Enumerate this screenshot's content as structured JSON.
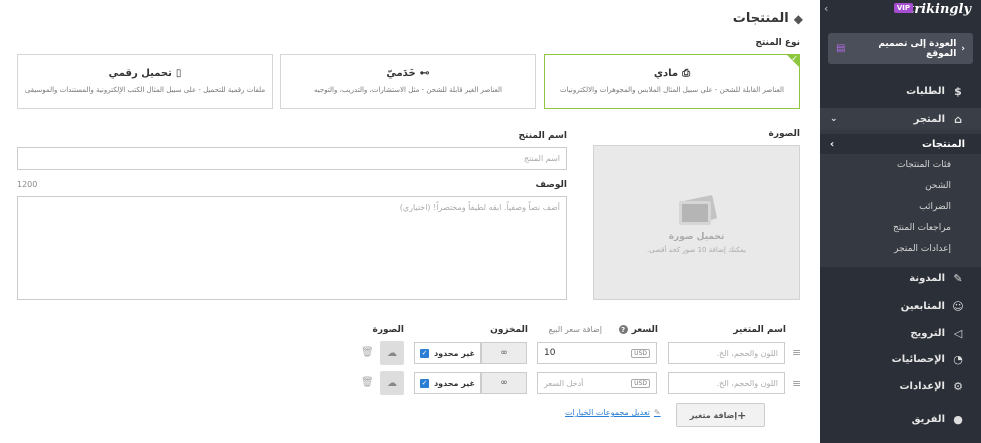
{
  "sidebar": {
    "logo": "strikingly",
    "vip": "VIP",
    "collapse": "‹",
    "back_label": "العودة إلى تصميم الموقع",
    "orders": "الطلبات",
    "store": "المتجر",
    "products": "المنتجات",
    "sub_items": [
      "فئات المنتجات",
      "الشحن",
      "الضرائب",
      "مراجعات المنتج",
      "إعدادات المتجر"
    ],
    "blog": "المدونة",
    "followers": "المتابعين",
    "promotion": "الترويج",
    "stats": "الإحصائيات",
    "settings": "الإعدادات",
    "team": "الفريق"
  },
  "main": {
    "title": "المنتجات",
    "product_type_label": "نوع المنتج",
    "types": [
      {
        "title": "مادي",
        "desc": "العناصر القابلة للشحن - على سبيل المثال الملابس والمجوهرات والالكترونيات"
      },
      {
        "title": "خَدَميّ",
        "desc": "العناصر الغير قابلة للشحن - مثل الاستشارات، والتدريب، والتوجيه"
      },
      {
        "title": "تحميل رقمي",
        "desc": "ملفات رقمية للتحميل - على سبيل المثال الكتب الإلكترونية والمستندات والموسيقى"
      }
    ],
    "image_label": "الصورة",
    "upload_title": "تحميل صورة",
    "upload_hint": "يمكنك إضافة 10 صور كحد أقصى.",
    "name_label": "اسم المنتج",
    "name_placeholder": "اسم المنتج",
    "desc_label": "الوصف",
    "desc_counter": "1200",
    "desc_placeholder": "أضف نصاً وصفياً. ابقه لطيفاً ومختصراً! (اختياري)",
    "variants": {
      "col_name": "اسم المتغير",
      "col_price": "السعر",
      "col_sale": "إضافة سعر البيع",
      "col_stock": "المخزون",
      "col_image": "الصورة",
      "variant_placeholder": "اللون والحجم، الخ.",
      "currency": "USD",
      "price_placeholder": "أدخل السعر",
      "rows": [
        {
          "price": "10",
          "stock": "∞",
          "unlimited": "غير محدود"
        },
        {
          "price": "",
          "stock": "∞",
          "unlimited": "غير محدود"
        }
      ],
      "add_button": "إضافة متغير",
      "edit_groups": "تعديل مجموعات الخيارات"
    }
  }
}
